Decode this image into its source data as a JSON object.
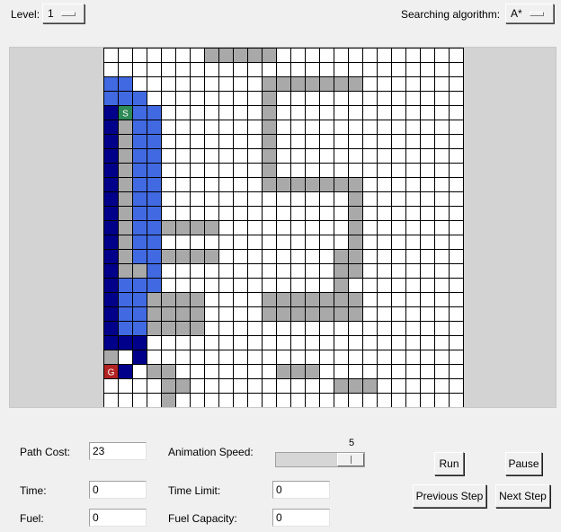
{
  "toolbar": {
    "level_label": "Level:",
    "level_value": "1",
    "algorithm_label": "Searching algorithm:",
    "algorithm_value": "A*"
  },
  "grid": {
    "cols": 25,
    "rows": 25,
    "start_label": "S",
    "goal_label": "G",
    "colors": {
      "empty": "#ffffff",
      "wall": "#a9a9a9",
      "frontier": "#4169e1",
      "visited": "#00008b",
      "start": "#2e8b57",
      "goal": "#b22222"
    },
    "start": [
      4,
      1
    ],
    "goal": [
      22,
      0
    ],
    "walls": [
      [
        0,
        7
      ],
      [
        0,
        8
      ],
      [
        0,
        9
      ],
      [
        0,
        10
      ],
      [
        0,
        11
      ],
      [
        2,
        11
      ],
      [
        2,
        12
      ],
      [
        2,
        13
      ],
      [
        2,
        14
      ],
      [
        2,
        15
      ],
      [
        2,
        16
      ],
      [
        2,
        17
      ],
      [
        3,
        11
      ],
      [
        4,
        11
      ],
      [
        5,
        11
      ],
      [
        6,
        11
      ],
      [
        7,
        11
      ],
      [
        8,
        11
      ],
      [
        9,
        11
      ],
      [
        9,
        12
      ],
      [
        9,
        13
      ],
      [
        9,
        14
      ],
      [
        9,
        15
      ],
      [
        9,
        16
      ],
      [
        9,
        17
      ],
      [
        10,
        17
      ],
      [
        11,
        17
      ],
      [
        12,
        17
      ],
      [
        12,
        4
      ],
      [
        12,
        5
      ],
      [
        12,
        6
      ],
      [
        12,
        7
      ],
      [
        13,
        17
      ],
      [
        14,
        4
      ],
      [
        14,
        5
      ],
      [
        14,
        6
      ],
      [
        14,
        7
      ],
      [
        14,
        16
      ],
      [
        14,
        17
      ],
      [
        15,
        16
      ],
      [
        15,
        17
      ],
      [
        15,
        1
      ],
      [
        15,
        2
      ],
      [
        16,
        16
      ],
      [
        17,
        3
      ],
      [
        17,
        4
      ],
      [
        17,
        5
      ],
      [
        17,
        6
      ],
      [
        17,
        11
      ],
      [
        17,
        12
      ],
      [
        17,
        13
      ],
      [
        17,
        14
      ],
      [
        17,
        15
      ],
      [
        17,
        16
      ],
      [
        17,
        17
      ],
      [
        18,
        3
      ],
      [
        18,
        4
      ],
      [
        18,
        5
      ],
      [
        18,
        6
      ],
      [
        18,
        11
      ],
      [
        18,
        12
      ],
      [
        18,
        13
      ],
      [
        18,
        14
      ],
      [
        18,
        15
      ],
      [
        18,
        16
      ],
      [
        18,
        17
      ],
      [
        19,
        3
      ],
      [
        19,
        4
      ],
      [
        19,
        5
      ],
      [
        19,
        6
      ],
      [
        20,
        0
      ],
      [
        20,
        1
      ],
      [
        21,
        0
      ],
      [
        22,
        3
      ],
      [
        22,
        4
      ],
      [
        22,
        12
      ],
      [
        22,
        13
      ],
      [
        22,
        14
      ],
      [
        23,
        4
      ],
      [
        23,
        5
      ],
      [
        23,
        16
      ],
      [
        23,
        17
      ],
      [
        23,
        18
      ],
      [
        24,
        4
      ]
    ],
    "visited_cells": [
      [
        4,
        0
      ],
      [
        5,
        0
      ],
      [
        6,
        0
      ],
      [
        7,
        0
      ],
      [
        8,
        0
      ],
      [
        9,
        0
      ],
      [
        10,
        0
      ],
      [
        11,
        0
      ],
      [
        12,
        0
      ],
      [
        13,
        0
      ],
      [
        14,
        0
      ],
      [
        15,
        0
      ],
      [
        16,
        0
      ],
      [
        17,
        0
      ],
      [
        18,
        0
      ],
      [
        19,
        0
      ],
      [
        20,
        0
      ],
      [
        20,
        1
      ],
      [
        20,
        2
      ],
      [
        21,
        2
      ],
      [
        22,
        1
      ]
    ],
    "frontier_cells": [
      [
        2,
        0
      ],
      [
        2,
        1
      ],
      [
        3,
        0
      ],
      [
        3,
        1
      ],
      [
        3,
        2
      ],
      [
        4,
        2
      ],
      [
        4,
        3
      ],
      [
        5,
        2
      ],
      [
        5,
        3
      ],
      [
        6,
        2
      ],
      [
        6,
        3
      ],
      [
        7,
        2
      ],
      [
        7,
        3
      ],
      [
        8,
        2
      ],
      [
        8,
        3
      ],
      [
        9,
        2
      ],
      [
        9,
        3
      ],
      [
        10,
        2
      ],
      [
        10,
        3
      ],
      [
        11,
        2
      ],
      [
        11,
        3
      ],
      [
        12,
        2
      ],
      [
        12,
        3
      ],
      [
        13,
        2
      ],
      [
        13,
        3
      ],
      [
        14,
        2
      ],
      [
        14,
        3
      ],
      [
        15,
        3
      ],
      [
        16,
        1
      ],
      [
        16,
        2
      ],
      [
        16,
        3
      ],
      [
        17,
        1
      ],
      [
        17,
        2
      ],
      [
        18,
        1
      ],
      [
        18,
        2
      ],
      [
        19,
        1
      ],
      [
        19,
        2
      ]
    ],
    "path_cells": [
      [
        5,
        1
      ],
      [
        6,
        1
      ],
      [
        7,
        1
      ],
      [
        8,
        1
      ],
      [
        9,
        1
      ],
      [
        10,
        1
      ],
      [
        11,
        1
      ],
      [
        12,
        1
      ],
      [
        13,
        1
      ],
      [
        14,
        1
      ]
    ]
  },
  "controls": {
    "path_cost_label": "Path Cost:",
    "path_cost_value": "23",
    "time_label": "Time:",
    "time_value": "0",
    "fuel_label": "Fuel:",
    "fuel_value": "0",
    "animation_speed_label": "Animation Speed:",
    "animation_speed_value": "5",
    "animation_speed_max": 5,
    "animation_speed_min": 1,
    "time_limit_label": "Time Limit:",
    "time_limit_value": "0",
    "fuel_capacity_label": "Fuel Capacity:",
    "fuel_capacity_value": "0",
    "run_label": "Run",
    "pause_label": "Pause",
    "prev_label": "Previous Step",
    "next_label": "Next Step"
  }
}
